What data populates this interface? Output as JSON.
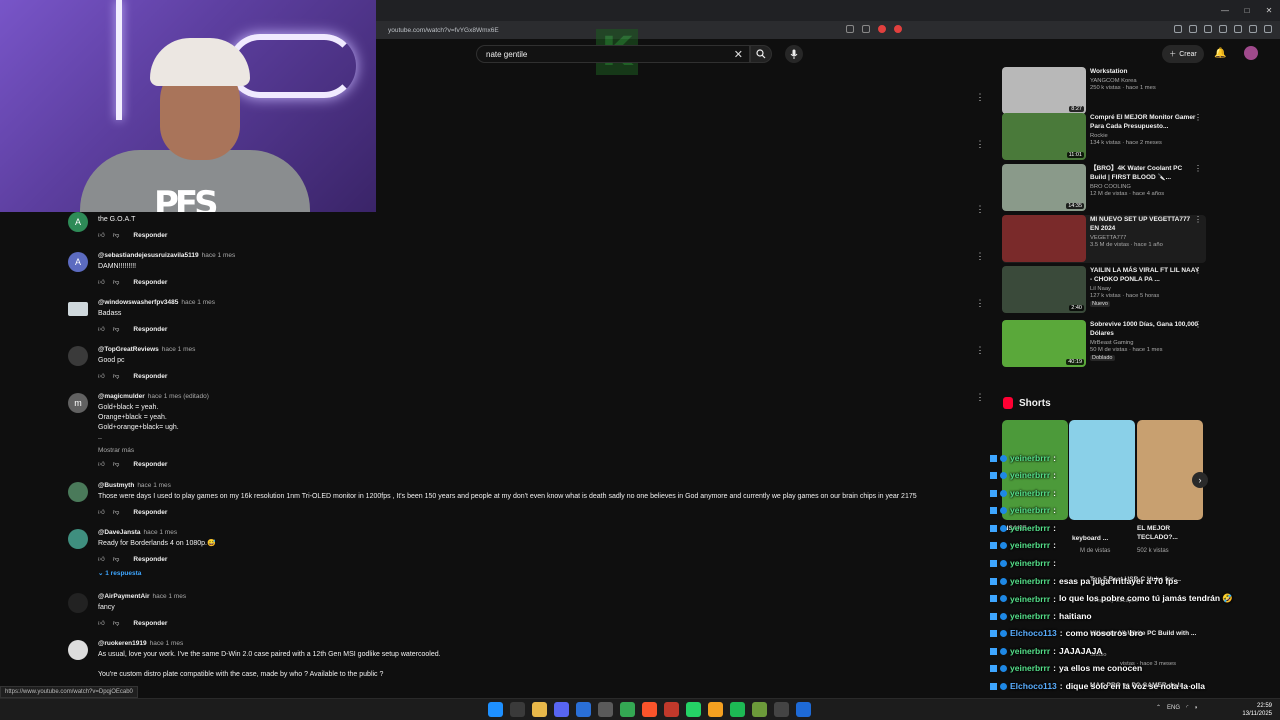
{
  "browser": {
    "url": "youtube.com/watch?v=fvYGx8Wmx6E",
    "status_url": "https://www.youtube.com/watch?v=DpqjOEcab0"
  },
  "header": {
    "search_value": "nate gentile",
    "create_label": "Crear"
  },
  "comments": [
    {
      "author": "",
      "time": "",
      "text": "the G.O.A.T",
      "avatar_letter": "A",
      "avatar_color": "#2e8b57",
      "reply": "Responder"
    },
    {
      "author": "@sebastiandejesusruizavila5119",
      "time": "hace 1 mes",
      "text": "DAMN!!!!!!!!!",
      "avatar_letter": "A",
      "avatar_color": "#5c6bc0",
      "reply": "Responder"
    },
    {
      "author": "@windowswasherfpv3485",
      "time": "hace 1 mes",
      "text": "Badass",
      "avatar_letter": "",
      "avatar_color": "#cfd8dc",
      "reply": "Responder"
    },
    {
      "author": "@TopGreatReviews",
      "time": "hace 1 mes",
      "text": "Good pc",
      "avatar_letter": "",
      "avatar_color": "#3a3a3a",
      "reply": "Responder"
    },
    {
      "author": "@magicmulder",
      "time": "hace 1 mes (editado)",
      "text": "Gold+black = yeah.\nOrange+black = yeah.\nGold+orange+black= ugh.\n..",
      "avatar_letter": "m",
      "avatar_color": "#616161",
      "more": "Mostrar más",
      "reply": "Responder"
    },
    {
      "author": "@Bustmyth",
      "time": "hace 1 mes",
      "text": "Those were days I used to play games on my 16k resolution 1nm Tri-OLED monitor in 1200fps , It's been 150 years and people at my don't even know what is death sadly no one believes in God anymore and currently we play games on our brain chips in year 2175",
      "avatar_letter": "",
      "avatar_color": "#4a7a5a",
      "reply": "Responder"
    },
    {
      "author": "@DaveJansta",
      "time": "hace 1 mes",
      "text": "Ready for Borderlands 4 on 1080p.😅",
      "avatar_letter": "",
      "avatar_color": "#3f8f7f",
      "reply": "Responder",
      "replies": "1 respuesta"
    },
    {
      "author": "@AirPaymentAir",
      "time": "hace 1 mes",
      "text": "fancy",
      "avatar_letter": "",
      "avatar_color": "#222",
      "reply": "Responder"
    },
    {
      "author": "@ruokeren1919",
      "time": "hace 1 mes",
      "text": "As usual, love your work.  I've the same D-Win 2.0 case paired with a 12th Gen MSI godlike setup watercooled.\n\nYou're custom distro plate compatible with the case, made by who ? Available to the public ?",
      "avatar_letter": "",
      "avatar_color": "#ddd",
      "reply": ""
    }
  ],
  "recommendations": [
    {
      "title": "Workstation",
      "channel": "YANGCOM Korea",
      "stats": "250 k vistas · hace 1 mes",
      "duration": "8:27",
      "color": "#b8b8b8"
    },
    {
      "title": "Compré El MEJOR Monitor Gamer Para Cada Presupuesto...",
      "channel": "Rockie",
      "stats": "134 k vistas · hace 2 meses",
      "duration": "11:01",
      "color": "#4a7a3a"
    },
    {
      "title": "【BRO】4K Water Coolant PC Build | FIRST BLOOD 🔪...",
      "channel": "BRO COOLING",
      "stats": "12 M de vistas · hace 4 años",
      "duration": "14:35",
      "color": "#8a9a8a"
    },
    {
      "title": "MI NUEVO SET UP VEGETTA777 EN 2024",
      "channel": "VEGETTA777",
      "stats": "3.5 M de vistas · hace 1 año",
      "duration": "",
      "color": "#7a2a2a"
    },
    {
      "title": "YAILIN LA MÁS VIRAL FT LIL NAAY - CHOKO PONLA PA ...",
      "channel": "Lil Naay",
      "stats": "127 k vistas · hace 5 horas",
      "duration": "2:40",
      "color": "#3a4a3a",
      "badge": "Nuevo"
    },
    {
      "title": "Sobrevive 1000 Días, Gana 100,000 Dólares",
      "channel": "MrBeast Gaming",
      "stats": "50 M de vistas · hace 1 mes",
      "duration": "40:19",
      "color": "#5aa83a",
      "badge": "Doblado"
    }
  ],
  "shorts": {
    "heading": "Shorts",
    "items": [
      {
        "title": "INSANE",
        "views": "",
        "color": "#4c9a3a"
      },
      {
        "title": "keyboard ...",
        "views": "M de vistas",
        "color": "#8ad0e8"
      },
      {
        "title": "EL MEJOR TECLADO?...",
        "views": "502 k vistas",
        "color": "#c8a070"
      }
    ]
  },
  "more_recs": [
    {
      "title": "Top 5 Best USB-C Hubs for ...",
      "channel": "Everyday Escapes"
    },
    {
      "title": "Ultimate All-White PC Build with ...",
      "channel": "Studio",
      "stats": "vistas · hace 3 meses"
    },
    {
      "title": "MAC PRO vs PC GAMER de la ...",
      "channel": ""
    }
  ],
  "chat": [
    {
      "user": "yeinerbrrr",
      "msg": ""
    },
    {
      "user": "yeinerbrrr",
      "msg": ""
    },
    {
      "user": "yeinerbrrr",
      "msg": ""
    },
    {
      "user": "yeinerbrrr",
      "msg": ""
    },
    {
      "user": "yeinerbrrr",
      "msg": ""
    },
    {
      "user": "yeinerbrrr",
      "msg": ""
    },
    {
      "user": "yeinerbrrr",
      "msg": ""
    },
    {
      "user": "yeinerbrrr",
      "msg": "esas pa juga fritfayer a 70 fps"
    },
    {
      "user": "yeinerbrrr",
      "msg": "lo que los pobre como tú jamás tendrán 🤣"
    },
    {
      "user": "yeinerbrrr",
      "msg": "haitiano"
    },
    {
      "user": "Elchoco113",
      "msg": "como nosotros bro"
    },
    {
      "user": "yeinerbrrr",
      "msg": "JAJAJAJA"
    },
    {
      "user": "yeinerbrrr",
      "msg": "ya ellos me conocen"
    },
    {
      "user": "Elchoco113",
      "msg": "dique solo en la voz se nota la olla"
    },
    {
      "user": "yeinerbrrr",
      "msg": "ok papi"
    }
  ],
  "taskbar": {
    "lang": "ENG",
    "time": "22:59",
    "date": "13/11/2025"
  }
}
